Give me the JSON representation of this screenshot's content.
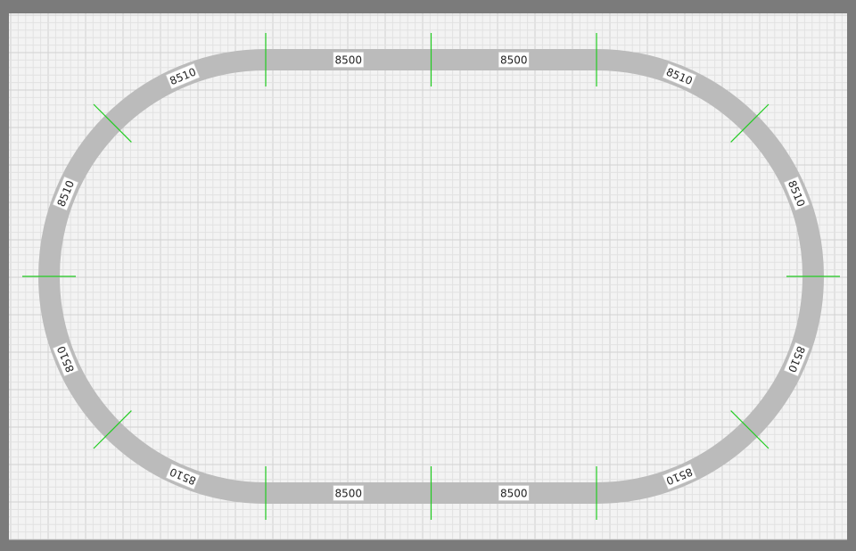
{
  "layout": {
    "colors": {
      "window_frame": "#7b7b7b",
      "canvas_background": "#f3f3f3",
      "grid_minor": "#e2e2e2",
      "grid_major": "#d2d2d2",
      "track": "#bbbbbb",
      "joint_marker": "#22cc22",
      "label_background": "#ffffff",
      "label_border": "#cfcfcf"
    },
    "track_pieces": [
      {
        "id": "straight-top-left",
        "part": "8500",
        "kind": "straight"
      },
      {
        "id": "straight-top-right",
        "part": "8500",
        "kind": "straight"
      },
      {
        "id": "curve-right-1",
        "part": "8510",
        "kind": "curve"
      },
      {
        "id": "curve-right-2",
        "part": "8510",
        "kind": "curve"
      },
      {
        "id": "curve-right-3",
        "part": "8510",
        "kind": "curve"
      },
      {
        "id": "curve-right-4",
        "part": "8510",
        "kind": "curve"
      },
      {
        "id": "straight-bottom-right",
        "part": "8500",
        "kind": "straight"
      },
      {
        "id": "straight-bottom-left",
        "part": "8500",
        "kind": "straight"
      },
      {
        "id": "curve-left-1",
        "part": "8510",
        "kind": "curve"
      },
      {
        "id": "curve-left-2",
        "part": "8510",
        "kind": "curve"
      },
      {
        "id": "curve-left-3",
        "part": "8510",
        "kind": "curve"
      },
      {
        "id": "curve-left-4",
        "part": "8510",
        "kind": "curve"
      }
    ]
  }
}
